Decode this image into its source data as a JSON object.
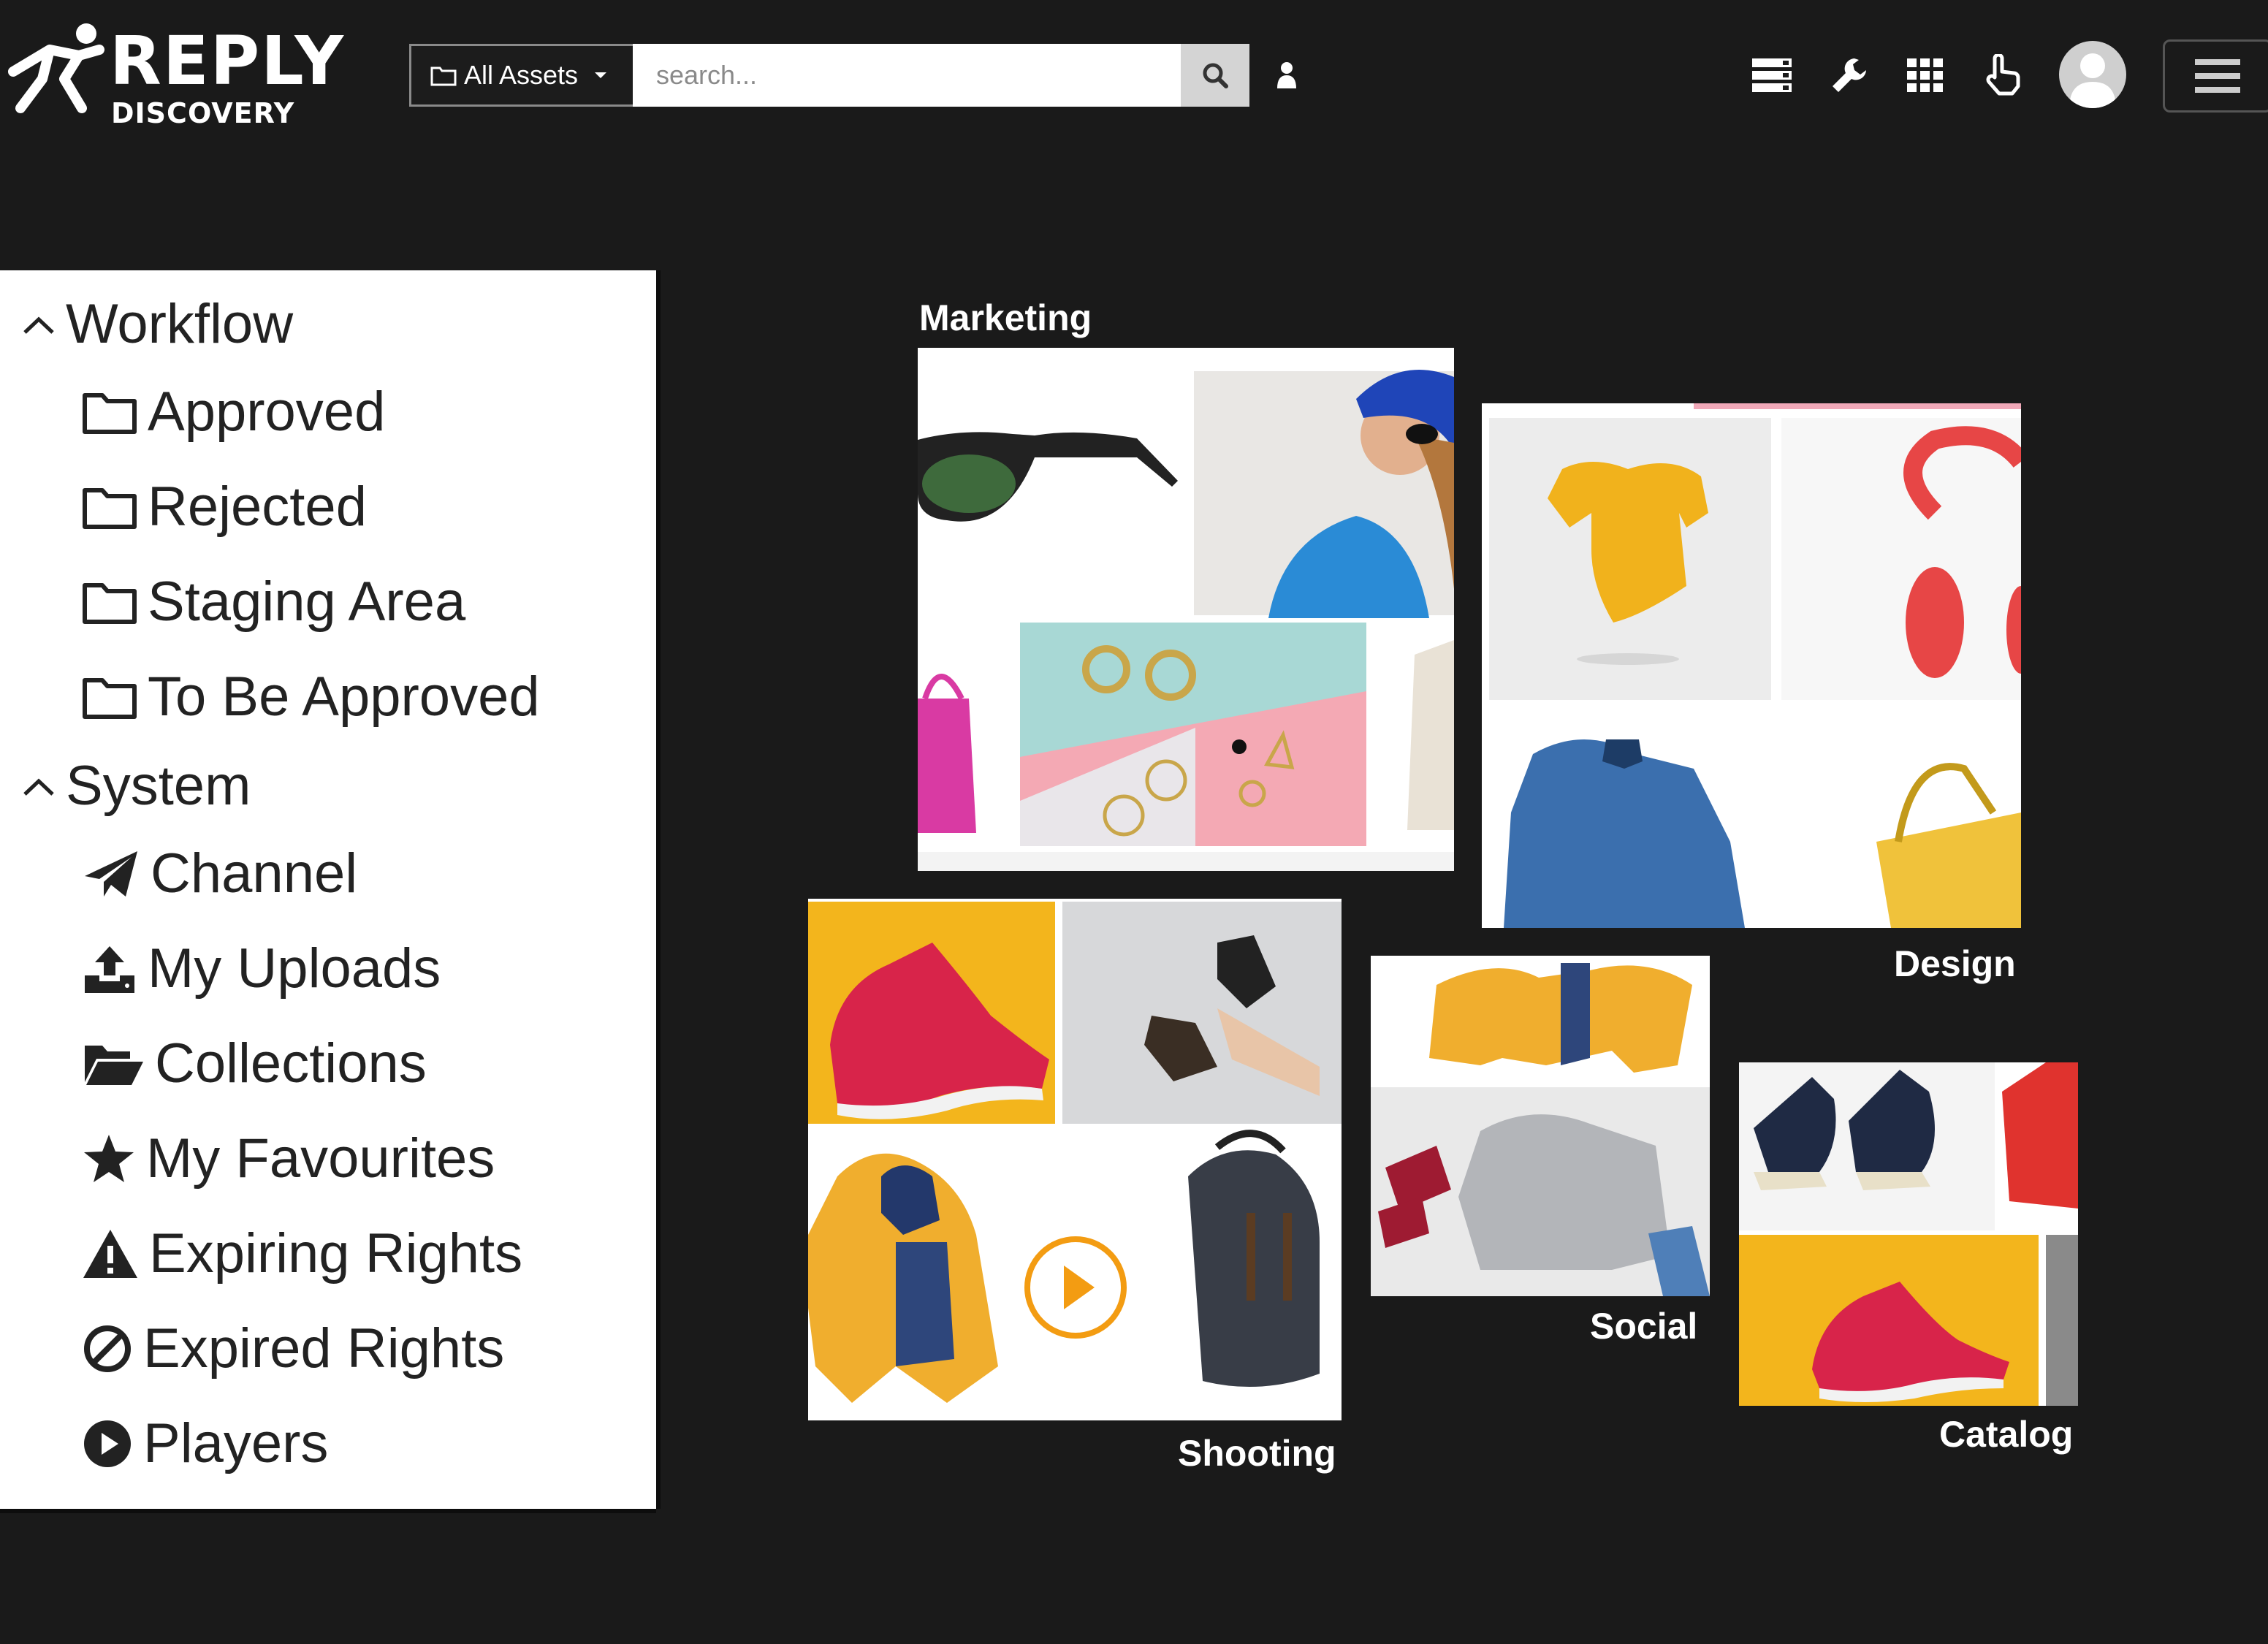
{
  "header": {
    "brand": "REPLY",
    "brand_sub": "DISCOVERY",
    "scope_label": "All Assets",
    "search_placeholder": "search...",
    "icons": [
      "user-icon",
      "list-icon",
      "wrench-icon",
      "grid-icon",
      "pointer-icon",
      "avatar-icon",
      "menu-icon"
    ]
  },
  "sidebar": {
    "workflow": {
      "title": "Workflow",
      "items": [
        {
          "label": "Approved",
          "icon": "folder-icon"
        },
        {
          "label": "Rejected",
          "icon": "folder-icon"
        },
        {
          "label": "Staging Area",
          "icon": "folder-icon"
        },
        {
          "label": "To Be Approved",
          "icon": "folder-icon"
        }
      ]
    },
    "system": {
      "title": "System",
      "items": [
        {
          "label": "Channel",
          "icon": "paper-plane-icon"
        },
        {
          "label": "My Uploads",
          "icon": "upload-icon"
        },
        {
          "label": "Collections",
          "icon": "folder-open-icon"
        },
        {
          "label": "My Favourites",
          "icon": "star-icon"
        },
        {
          "label": "Expiring Rights",
          "icon": "warning-icon"
        },
        {
          "label": "Expired Rights",
          "icon": "ban-icon"
        },
        {
          "label": "Players",
          "icon": "play-circle-icon"
        }
      ]
    }
  },
  "collections": [
    {
      "label": "Marketing"
    },
    {
      "label": "Design"
    },
    {
      "label": "Shooting"
    },
    {
      "label": "Social"
    },
    {
      "label": "Catalog"
    }
  ],
  "colors": {
    "background": "#1a1a1a",
    "accent": "#f39c12",
    "yellow": "#f3b51c"
  }
}
